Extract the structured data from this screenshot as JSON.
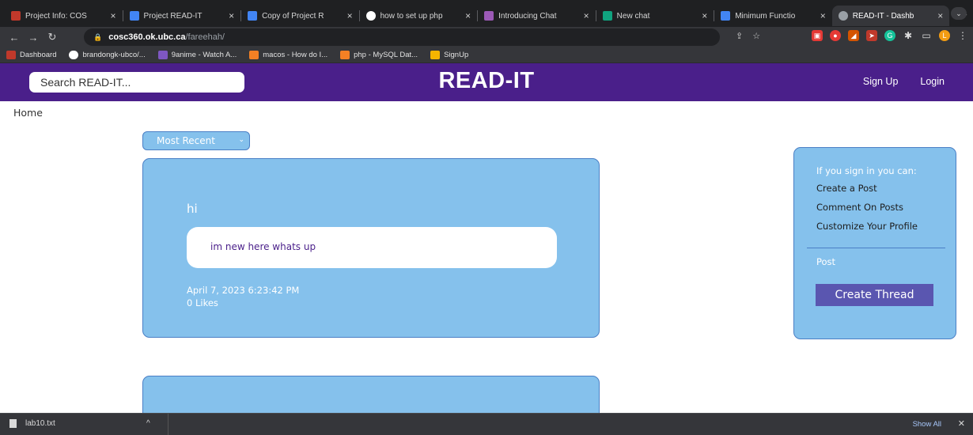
{
  "browser": {
    "tabs": [
      {
        "title": "Project Info: COS",
        "favicon_color": "#c0392b",
        "favicon": "ubc-icon"
      },
      {
        "title": "Project READ-IT",
        "favicon_color": "#4285f4",
        "favicon": "docs-icon"
      },
      {
        "title": "Copy of Project R",
        "favicon_color": "#4285f4",
        "favicon": "docs-icon"
      },
      {
        "title": "how to set up php",
        "favicon_color": "#ffffff",
        "favicon": "google-icon"
      },
      {
        "title": "Introducing Chat",
        "favicon_color": "#9b59b6",
        "favicon": "chatgpt-icon"
      },
      {
        "title": "New chat",
        "favicon_color": "#10a37f",
        "favicon": "chatgpt-icon"
      },
      {
        "title": "Minimum Functio",
        "favicon_color": "#4285f4",
        "favicon": "docs-icon"
      },
      {
        "title": "READ-IT - Dashb",
        "favicon_color": "#9aa0a6",
        "favicon": "globe-icon",
        "active": true
      }
    ],
    "address": {
      "host": "cosc360.ok.ubc.ca",
      "path": "/fareehah/"
    },
    "bookmarks": [
      {
        "label": "Dashboard",
        "color": "#c0392b"
      },
      {
        "label": "brandongk-ubco/...",
        "color": "#ffffff"
      },
      {
        "label": "9anime - Watch A...",
        "color": "#7e57c2"
      },
      {
        "label": "macos - How do I...",
        "color": "#f48024"
      },
      {
        "label": "php - MySQL Dat...",
        "color": "#f48024"
      },
      {
        "label": "SignUp",
        "color": "#f5b400"
      }
    ]
  },
  "site": {
    "search_placeholder": "Search READ-IT...",
    "logo": "READ-IT",
    "nav": {
      "signup": "Sign Up",
      "login": "Login"
    },
    "breadcrumb": "Home",
    "sort": {
      "selected": "Most Recent"
    },
    "posts": [
      {
        "title": "hi",
        "body": "im new here whats up",
        "date": "April 7, 2023 6:23:42 PM",
        "likes": "0 Likes"
      }
    ],
    "sidebar": {
      "heading": "If you sign in you can:",
      "items": [
        "Create a Post",
        "Comment On Posts",
        "Customize Your Profile"
      ],
      "post_label": "Post",
      "create_button": "Create Thread"
    }
  },
  "download_bar": {
    "file": "lab10.txt",
    "show_all": "Show All"
  },
  "colors": {
    "header": "#4a1f8a",
    "card": "#85c1ec",
    "card_border": "#4a7fc5",
    "button": "#5a56b0"
  }
}
